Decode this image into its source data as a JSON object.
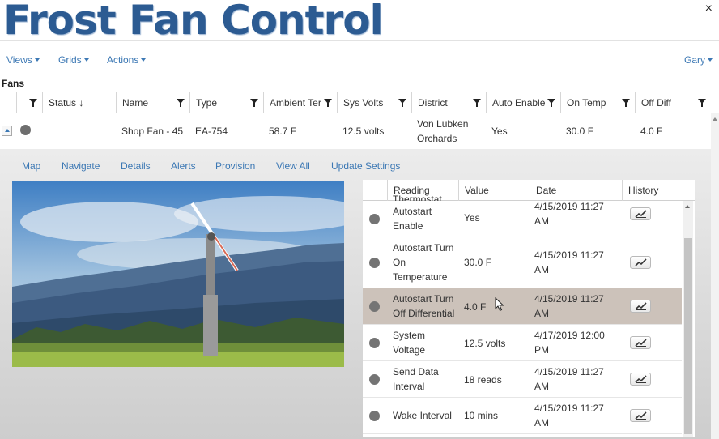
{
  "app": {
    "title": "Frost Fan Control",
    "close_label": "×"
  },
  "menu": {
    "views": "Views",
    "grids": "Grids",
    "actions": "Actions",
    "user": "Gary"
  },
  "section": {
    "label": "Fans"
  },
  "grid": {
    "columns": [
      "Status",
      "Name",
      "Type",
      "Ambient Ter",
      "Sys Volts",
      "District",
      "Auto Enable",
      "On Temp",
      "Off Diff"
    ],
    "sort_indicator": "↓",
    "row": {
      "status": "",
      "name": "Shop Fan - 45",
      "type": "EA-754",
      "ambient_temp": "58.7 F",
      "sys_volts": "12.5 volts",
      "district_line1": "Von Lubken",
      "district_line2": "Orchards",
      "auto_enable": "Yes",
      "on_temp": "30.0 F",
      "off_diff": "4.0 F"
    }
  },
  "detail_links": [
    "Map",
    "Navigate",
    "Details",
    "Alerts",
    "Provision",
    "View All",
    "Update Settings"
  ],
  "readings": {
    "columns": [
      "Reading",
      "Value",
      "Date",
      "History"
    ],
    "partial_top_label": "Thermostat",
    "rows": [
      {
        "reading": [
          "Autostart",
          "Enable"
        ],
        "value": "Yes",
        "date": [
          "4/15/2019 11:27",
          "AM"
        ]
      },
      {
        "reading": [
          "Autostart Turn",
          "On",
          "Temperature"
        ],
        "value": "30.0 F",
        "date": [
          "4/15/2019 11:27",
          "AM"
        ]
      },
      {
        "reading": [
          "Autostart Turn",
          "Off Differential"
        ],
        "value": "4.0 F",
        "date": [
          "4/15/2019 11:27",
          "AM"
        ]
      },
      {
        "reading": [
          "System",
          "Voltage"
        ],
        "value": "12.5 volts",
        "date": [
          "4/17/2019 12:00",
          "PM"
        ]
      },
      {
        "reading": [
          "Send Data",
          "Interval"
        ],
        "value": "18 reads",
        "date": [
          "4/15/2019 11:27",
          "AM"
        ]
      },
      {
        "reading": [
          "Wake Interval"
        ],
        "value": "10 mins",
        "date": [
          "4/15/2019 11:27",
          "AM"
        ]
      }
    ]
  },
  "colors": {
    "title": "#2c5b92",
    "link": "#3c78b4",
    "highlight_row": "#ccc2ba",
    "status_dot": "#6e6e6e"
  },
  "icons": {
    "filter": "filter-icon",
    "history": "chart-line-icon",
    "close": "close-icon"
  }
}
